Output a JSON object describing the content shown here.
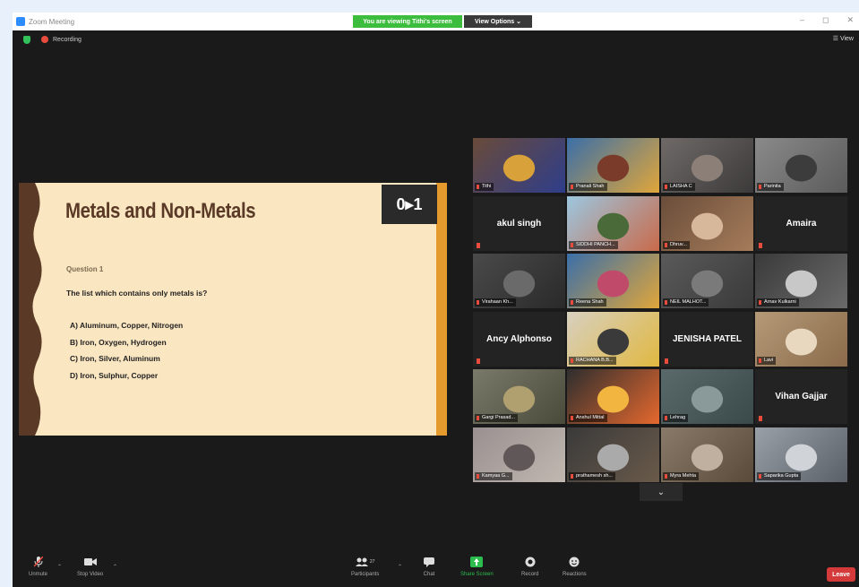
{
  "window": {
    "title": "Zoom Meeting",
    "controls": [
      "–",
      "◻",
      "✕"
    ]
  },
  "banner": {
    "viewing": "You are viewing Tithi's screen",
    "view_options": "View Options ⌄"
  },
  "status": {
    "recording": "Recording",
    "view": "☰ View"
  },
  "slide": {
    "title": "Metals and Non-Metals",
    "logo_text": "0▸1",
    "question_label": "Question 1",
    "question_text": "The list which contains only metals is?",
    "options": [
      "A) Aluminum, Copper, Nitrogen",
      "B) Iron, Oxygen, Hydrogen",
      "C) Iron, Silver, Aluminum",
      "D) Iron, Sulphur, Copper"
    ]
  },
  "participants": [
    {
      "name": "Tithi",
      "type": "video",
      "active": true
    },
    {
      "name": "Pranali Shah",
      "type": "video"
    },
    {
      "name": "LAISHA C",
      "type": "video"
    },
    {
      "name": "Parinita",
      "type": "video"
    },
    {
      "name": "akul singh",
      "type": "name"
    },
    {
      "name": "SIDDHI PANCH...",
      "type": "video"
    },
    {
      "name": "Dhruv...",
      "type": "video"
    },
    {
      "name": "Amaira",
      "type": "name"
    },
    {
      "name": "Virahaan Kh...",
      "type": "video"
    },
    {
      "name": "Reena Shah",
      "type": "video"
    },
    {
      "name": "NEIL MALHOT...",
      "type": "video"
    },
    {
      "name": "Arnav Kulkarni",
      "type": "video"
    },
    {
      "name": "Ancy Alphonso",
      "type": "name"
    },
    {
      "name": "RACHANA B.B...",
      "type": "video"
    },
    {
      "name": "JENISHA PATEL",
      "type": "name"
    },
    {
      "name": "Lavi",
      "type": "video"
    },
    {
      "name": "Gargi Prasad...",
      "type": "video"
    },
    {
      "name": "Anshul Mittal",
      "type": "video"
    },
    {
      "name": "Lehrag",
      "type": "video"
    },
    {
      "name": "Vihan Gajjar",
      "type": "name"
    },
    {
      "name": "Kamyaa G...",
      "type": "video"
    },
    {
      "name": "prathamesh sh...",
      "type": "video"
    },
    {
      "name": "Myra Mehta",
      "type": "video"
    },
    {
      "name": "Saparika Gupta",
      "type": "video"
    }
  ],
  "toolbar": {
    "unmute": "Unmute",
    "stop_video": "Stop Video",
    "participants": "Participants",
    "participants_count": "27",
    "chat": "Chat",
    "share_screen": "Share Screen",
    "record": "Record",
    "reactions": "Reactions",
    "leave": "Leave"
  },
  "colors": {
    "accent_green": "#3dbd3d",
    "leave_red": "#d53a3a",
    "active_speaker": "#b5e23a",
    "slide_bg": "#fbe6c2",
    "slide_bar": "#e59a2e"
  }
}
